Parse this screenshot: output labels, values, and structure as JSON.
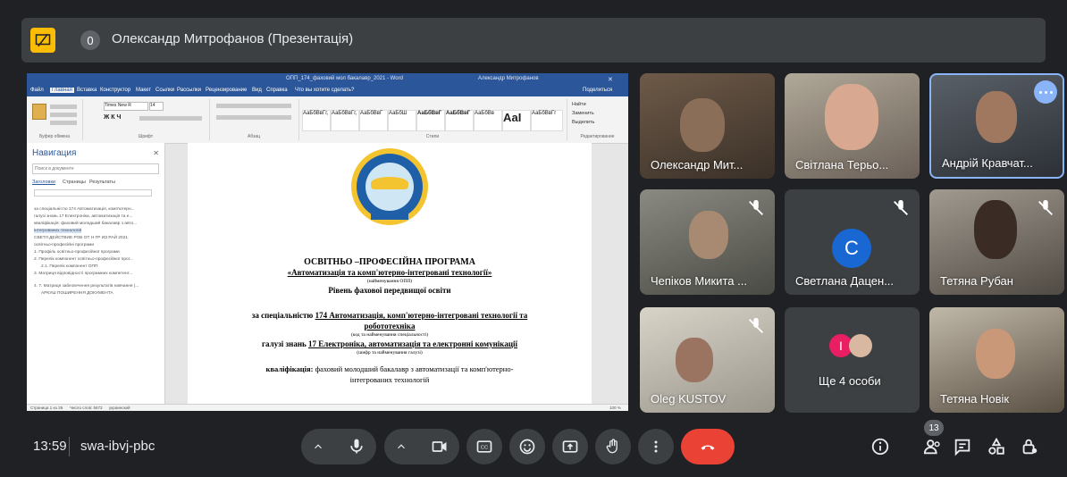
{
  "presentation": {
    "badge": "0",
    "title": "Олександр Митрофанов (Презентація)"
  },
  "word": {
    "title": "ОПП_174_фаховий мол бакалавр_2021 - Word",
    "user": "Александр Митрофанов",
    "menu": [
      "Файл",
      "Главная",
      "Вставка",
      "Конструктор",
      "Макет",
      "Ссылки",
      "Рассылки",
      "Рецензирование",
      "Вид",
      "Справка",
      "Что вы хотите сделать?"
    ],
    "share": "Поделиться",
    "ribbon_groups": [
      "Буфер обмена",
      "Шрифт",
      "Абзац",
      "Стили",
      "Редактирование"
    ],
    "font_name": "Times New R",
    "font_size": "14",
    "styles": [
      "АаБбВвГг,",
      "АаБбВвГг,",
      "АаБбВвГ",
      "АаБбШ",
      "АаБбВвГ",
      "АаБбВвГ",
      "АаБбВв",
      "АаI",
      "АаБбВвГг"
    ],
    "style_names": [
      "1 Обычный",
      "1 Table Pa...",
      "1 Без инт...",
      "Основной...",
      "Заголово...",
      "Заголово...",
      "1 Заголов...",
      "1 Заголов...",
      "Слабое в..."
    ],
    "editing": [
      "Найти",
      "Заменить",
      "Выделить"
    ],
    "nav": {
      "title": "Навигация",
      "search_placeholder": "Поиск в документе",
      "tabs": [
        "Заголовки",
        "Страницы",
        "Результаты"
      ],
      "items": [
        "за спеціальністю 174 Автоматизація, комп'ютерн...",
        "галузі знань 17 Електроніка, автоматизація та е...",
        "кваліфікація: фаховий молодший бакалавр з авто...",
        "інтегрованих технологій",
        "СВЕТЛ ДЕЙСТВИЕ РОБ ОТ Н ГР ИЗ РАЙ 2021",
        "освітньо-професійні програми",
        "1. Профіль освітньо-професійної програми",
        "2. Перелік компонент освітньо-професійної прог...",
        "2.1. Перелік компонент ОПП",
        "3. Матриця відповідності програмних компетент...",
        "4. 7. Матриця забезпечення результатів навчання (...",
        "АРКУШ ПОШИРЕННЯ ДОКУМЕНТА"
      ]
    },
    "doc": {
      "seal_top": "КРИВОРІЗЬКИЙ ФАХОВИЙ КОЛЕДЖ",
      "seal_year": "1951",
      "seal_bottom": "КРАУСС",
      "heading": "ОСВІТНЬО –ПРОФЕСІЙНА ПРОГРАМА",
      "program": "«Автоматизація та комп'ютерно-інтегровані технології»",
      "program_note": "(найменування ОПП)",
      "level": "Рівень фахової передвищої освіти",
      "specialty_lbl": "за спеціальністю",
      "specialty": "174 Автоматизація, комп'ютерно-інтегровані технології та",
      "specialty2": "робототехніка",
      "specialty_note": "(код та найменування спеціальності)",
      "field_lbl": "галузі знань",
      "field": "17 Електроніка, автоматизація та електронні комунікації",
      "field_note": "(шифр та найменування галузі)",
      "qual_lbl": "кваліфікація:",
      "qual": "фаховий молодший бакалавр з автоматизації та комп'ютерно-",
      "qual2": "інтегрованих технологій"
    },
    "status": {
      "page": "Страница 1 из 26",
      "words": "Число слов: 5673",
      "lang": "украинский",
      "zoom": "100 %"
    }
  },
  "participants": [
    {
      "name": "Олександр Мит...",
      "muted": false
    },
    {
      "name": "Світлана Терьо...",
      "muted": false
    },
    {
      "name": "Андрій Кравчат...",
      "muted": false
    },
    {
      "name": "Чепіков Микита ...",
      "muted": true
    },
    {
      "name": "Светлана Дацен...",
      "muted": true,
      "initial": "C",
      "color": "#1967d2"
    },
    {
      "name": "Тетяна Рубан",
      "muted": true
    },
    {
      "name": "Oleg KUSTOV",
      "muted": true
    },
    {
      "name": "Ще 4 особи",
      "muted": false,
      "initial": "I",
      "color": "#e91e63"
    },
    {
      "name": "Тетяна Новік",
      "muted": false
    }
  ],
  "bottom": {
    "time": "13:59",
    "code": "swa-ibvj-pbc",
    "people_count": "13"
  },
  "colors": {
    "bg": "#202124",
    "surface": "#3c4043",
    "accent": "#8ab4f8",
    "end_call": "#ea4335",
    "word_blue": "#2b579a"
  }
}
